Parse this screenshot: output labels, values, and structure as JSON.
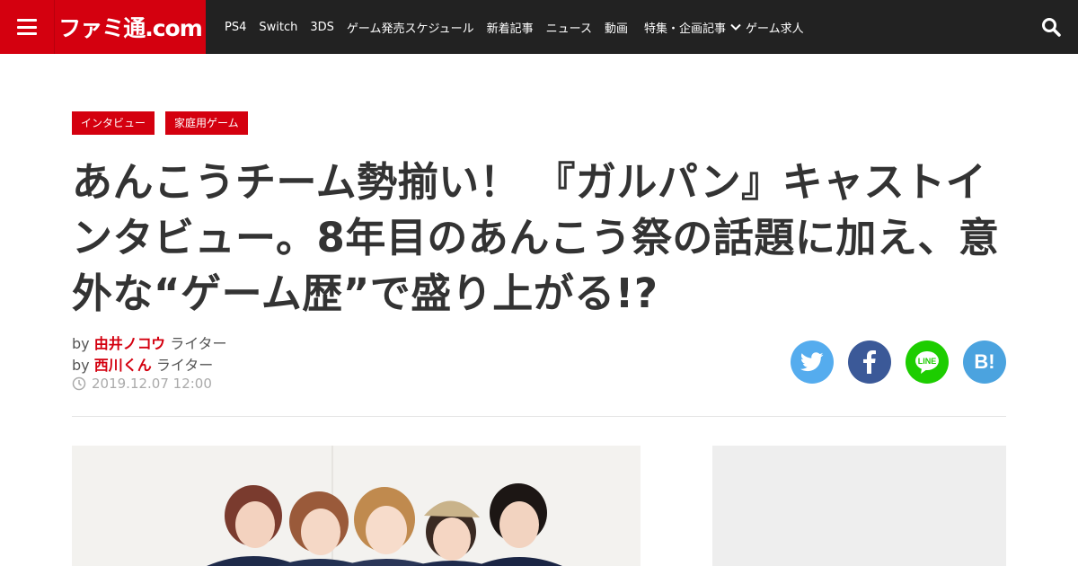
{
  "header": {
    "logo_text": "ファミ通.com",
    "nav": [
      "PS4",
      "Switch",
      "3DS",
      "ゲーム発売スケジュール",
      "新着記事",
      "ニュース",
      "動画"
    ],
    "nav_dropdown": "特集・企画記事",
    "nav_last": "ゲーム求人"
  },
  "article": {
    "tags": [
      "インタビュー",
      "家庭用ゲーム"
    ],
    "title": "あんこうチーム勢揃い！ 『ガルパン』キャストインタビュー。8年目のあんこう祭の話題に加え、意外な“ゲーム歴”で盛り上がる!?",
    "authors": [
      {
        "prefix": "by",
        "name": "由井ノコウ",
        "role": "ライター"
      },
      {
        "prefix": "by",
        "name": "西川くん",
        "role": "ライター"
      }
    ],
    "date": "2019.12.07 12:00"
  },
  "share": {
    "hatena_label": "B!"
  },
  "colors": {
    "brand_red": "#d4000f",
    "header_bg": "#222222",
    "twitter": "#55acee",
    "facebook": "#3b5998",
    "line": "#1dcd00",
    "hatena": "#4ba3df"
  }
}
